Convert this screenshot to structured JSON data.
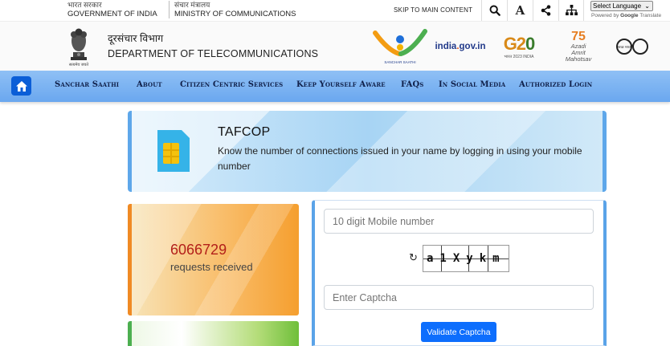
{
  "gov_strip": {
    "india_hindi": "भारत सरकार",
    "india_english": "GOVERNMENT OF INDIA",
    "ministry_hindi": "संचार मंत्रालय",
    "ministry_english": "MINISTRY OF COMMUNICATIONS",
    "skip_link": "SKIP TO MAIN CONTENT",
    "text_size_label": "A",
    "language_select": "Select Language",
    "powered_by": "Powered by",
    "google": "Google",
    "translate": "Translate"
  },
  "header": {
    "emblem_caption": "सत्यमेव जयते",
    "dept_hindi": "दूरसंचार विभाग",
    "dept_name": "DEPARTMENT OF TELECOMMUNICATIONS",
    "logos": {
      "saathi_caption": "SANCHAR SAATHI",
      "india_gov": "india",
      "india_gov_domain": "gov.in",
      "g20_g": "G2",
      "g20_zero": "0",
      "g20_sub": "भारत 2023 INDIA",
      "azadi_line1": "Azadi",
      "azadi_line2": "Amrit Mahotsav",
      "swachh_caption": "स्वच्छ भारत"
    }
  },
  "nav": {
    "items": [
      {
        "label": "Sanchar Saathi"
      },
      {
        "label": "About"
      },
      {
        "label": "Citizen Centric Services"
      },
      {
        "label": "Keep Yourself Aware"
      },
      {
        "label": "FAQs"
      },
      {
        "label": "In Social Media"
      },
      {
        "label": "Authorized Login"
      }
    ]
  },
  "banner": {
    "title": "TAFCOP",
    "description": "Know the number of connections issued in your name by logging in using your mobile number"
  },
  "stats": {
    "count": "6066729",
    "label": "requests received"
  },
  "form": {
    "mobile_placeholder": "10 digit Mobile number",
    "captcha_text": "a1Xykm",
    "captcha_placeholder": "Enter Captcha",
    "validate_label": "Validate Captcha"
  },
  "colors": {
    "nav_bg": "#7cb4f2",
    "primary_button": "#0d6efd",
    "stats_accent": "#f08a24",
    "count_color": "#b3201a"
  }
}
